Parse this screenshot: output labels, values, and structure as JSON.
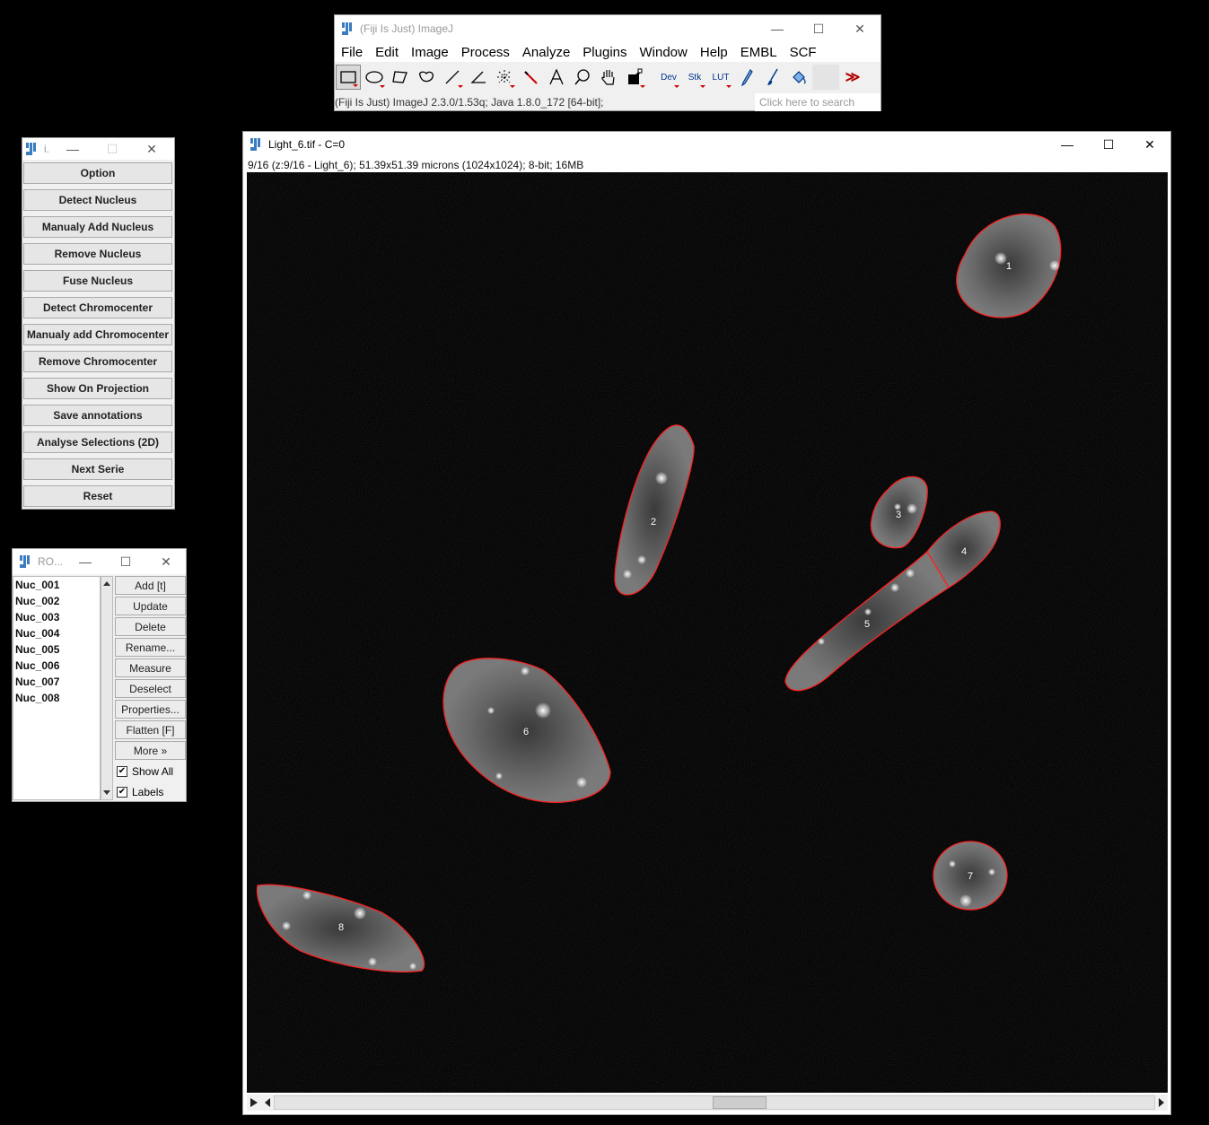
{
  "fiji": {
    "title": "(Fiji Is Just) ImageJ",
    "menus": [
      "File",
      "Edit",
      "Image",
      "Process",
      "Analyze",
      "Plugins",
      "Window",
      "Help",
      "EMBL",
      "SCF"
    ],
    "tools": [
      "rectangle-tool-icon",
      "oval-tool-icon",
      "polygon-tool-icon",
      "freehand-tool-icon",
      "line-tool-icon",
      "angle-tool-icon",
      "point-tool-icon",
      "wand-tool-icon",
      "text-tool-icon",
      "magnifier-tool-icon",
      "hand-tool-icon",
      "color-picker-tool-icon"
    ],
    "text_tools": {
      "dev": "Dev",
      "stk": "Stk",
      "lut": "LUT"
    },
    "more_tools": "≫",
    "status": "(Fiji Is Just) ImageJ 2.3.0/1.53q; Java 1.8.0_172 [64-bit];",
    "search_placeholder": "Click here to search"
  },
  "plugin_panel": {
    "title": "i.",
    "buttons": [
      "Option",
      "Detect Nucleus",
      "Manualy Add Nucleus",
      "Remove Nucleus",
      "Fuse Nucleus",
      "Detect Chromocenter",
      "Manualy add Chromocenter",
      "Remove Chromocenter",
      "Show On Projection",
      "Save annotations",
      "Analyse Selections (2D)",
      "Next Serie",
      "Reset"
    ]
  },
  "roi_manager": {
    "title": "RO...",
    "items": [
      "Nuc_001",
      "Nuc_002",
      "Nuc_003",
      "Nuc_004",
      "Nuc_005",
      "Nuc_006",
      "Nuc_007",
      "Nuc_008"
    ],
    "buttons": [
      "Add [t]",
      "Update",
      "Delete",
      "Rename...",
      "Measure",
      "Deselect",
      "Properties...",
      "Flatten [F]",
      "More »"
    ],
    "show_all": {
      "label": "Show All",
      "checked": true
    },
    "labels": {
      "label": "Labels",
      "checked": true
    }
  },
  "image_window": {
    "title": "Light_6.tif - C=0",
    "info": "9/16 (z:9/16 - Light_6); 51.39x51.39 microns (1024x1024); 8-bit; 16MB",
    "nuclei_labels": [
      "1",
      "2",
      "3",
      "4",
      "5",
      "6",
      "7",
      "8"
    ],
    "roi_color": "#ff2020"
  }
}
